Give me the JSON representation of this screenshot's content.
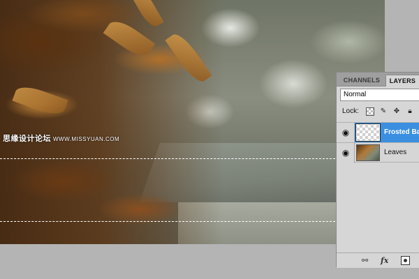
{
  "panel": {
    "tabs": [
      {
        "label": "CHANNELS"
      },
      {
        "label": "LAYERS"
      }
    ],
    "blend_mode": "Normal",
    "lock_label": "Lock:",
    "layers": [
      {
        "name": "Frosted Ba",
        "selected": true,
        "visible": true,
        "thumbnail": "transparent"
      },
      {
        "name": "Leaves",
        "selected": false,
        "visible": true,
        "thumbnail": "leaves-photo"
      }
    ],
    "footer_icons": [
      "link-icon",
      "fx-icon",
      "mask-icon"
    ],
    "fx_label": "fx"
  },
  "watermark": {
    "text": "思缘设计论坛",
    "site": "WWW.MISSYUAN.COM"
  },
  "colors": {
    "selection_highlight": "#3a8fe0",
    "panel_bg": "#d6d6d6",
    "workspace_bg": "#b4b4b4"
  }
}
